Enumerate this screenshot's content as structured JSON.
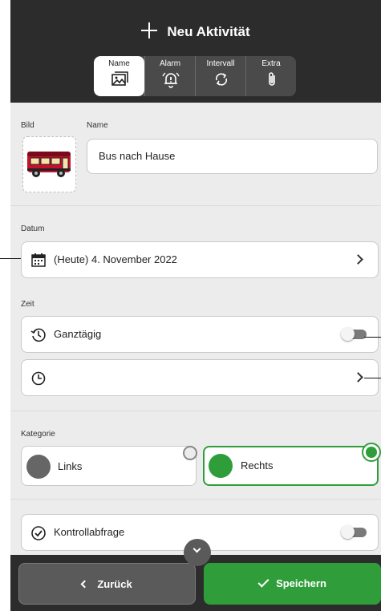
{
  "header": {
    "title": "Neu Aktivität",
    "tabs": [
      {
        "label": "Name",
        "icon": "image-icon",
        "active": true
      },
      {
        "label": "Alarm",
        "icon": "alarm-bell-icon",
        "active": false
      },
      {
        "label": "Intervall",
        "icon": "repeat-icon",
        "active": false
      },
      {
        "label": "Extra",
        "icon": "paperclip-icon",
        "active": false
      }
    ]
  },
  "name_section": {
    "image_label": "Bild",
    "name_label": "Name",
    "name_value": "Bus nach Hause",
    "image_icon": "bus-icon"
  },
  "date_section": {
    "label": "Datum",
    "value": "(Heute) 4. November 2022"
  },
  "time_section": {
    "label": "Zeit",
    "all_day_label": "Ganztägig",
    "all_day_enabled": false,
    "time_value": ""
  },
  "category_section": {
    "label": "Kategorie",
    "options": [
      {
        "label": "Links",
        "color": "#666666",
        "selected": false
      },
      {
        "label": "Rechts",
        "color": "#2f9e3a",
        "selected": true
      }
    ]
  },
  "check_section": {
    "label": "Kontrollabfrage",
    "enabled": false
  },
  "footer": {
    "back_label": "Zurück",
    "save_label": "Speichern"
  },
  "colors": {
    "accent_green": "#2f9e3a",
    "header_dark": "#2c2c2c"
  }
}
